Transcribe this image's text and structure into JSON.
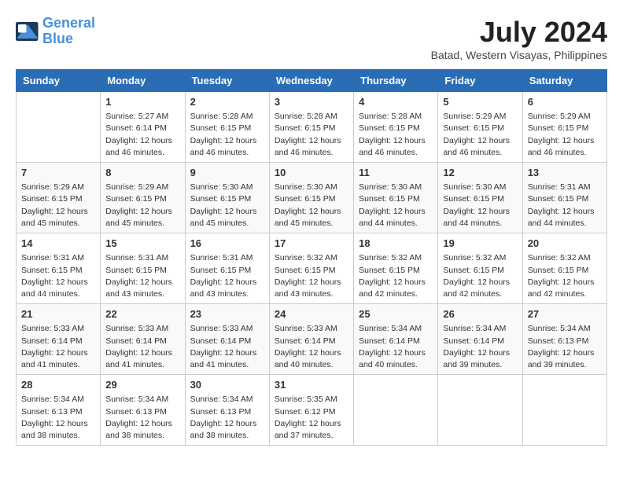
{
  "header": {
    "logo_line1": "General",
    "logo_line2": "Blue",
    "title": "July 2024",
    "subtitle": "Batad, Western Visayas, Philippines"
  },
  "columns": [
    "Sunday",
    "Monday",
    "Tuesday",
    "Wednesday",
    "Thursday",
    "Friday",
    "Saturday"
  ],
  "weeks": [
    {
      "days": [
        {
          "num": "",
          "info": ""
        },
        {
          "num": "1",
          "info": "Sunrise: 5:27 AM\nSunset: 6:14 PM\nDaylight: 12 hours\nand 46 minutes."
        },
        {
          "num": "2",
          "info": "Sunrise: 5:28 AM\nSunset: 6:15 PM\nDaylight: 12 hours\nand 46 minutes."
        },
        {
          "num": "3",
          "info": "Sunrise: 5:28 AM\nSunset: 6:15 PM\nDaylight: 12 hours\nand 46 minutes."
        },
        {
          "num": "4",
          "info": "Sunrise: 5:28 AM\nSunset: 6:15 PM\nDaylight: 12 hours\nand 46 minutes."
        },
        {
          "num": "5",
          "info": "Sunrise: 5:29 AM\nSunset: 6:15 PM\nDaylight: 12 hours\nand 46 minutes."
        },
        {
          "num": "6",
          "info": "Sunrise: 5:29 AM\nSunset: 6:15 PM\nDaylight: 12 hours\nand 46 minutes."
        }
      ]
    },
    {
      "days": [
        {
          "num": "7",
          "info": "Sunrise: 5:29 AM\nSunset: 6:15 PM\nDaylight: 12 hours\nand 45 minutes."
        },
        {
          "num": "8",
          "info": "Sunrise: 5:29 AM\nSunset: 6:15 PM\nDaylight: 12 hours\nand 45 minutes."
        },
        {
          "num": "9",
          "info": "Sunrise: 5:30 AM\nSunset: 6:15 PM\nDaylight: 12 hours\nand 45 minutes."
        },
        {
          "num": "10",
          "info": "Sunrise: 5:30 AM\nSunset: 6:15 PM\nDaylight: 12 hours\nand 45 minutes."
        },
        {
          "num": "11",
          "info": "Sunrise: 5:30 AM\nSunset: 6:15 PM\nDaylight: 12 hours\nand 44 minutes."
        },
        {
          "num": "12",
          "info": "Sunrise: 5:30 AM\nSunset: 6:15 PM\nDaylight: 12 hours\nand 44 minutes."
        },
        {
          "num": "13",
          "info": "Sunrise: 5:31 AM\nSunset: 6:15 PM\nDaylight: 12 hours\nand 44 minutes."
        }
      ]
    },
    {
      "days": [
        {
          "num": "14",
          "info": "Sunrise: 5:31 AM\nSunset: 6:15 PM\nDaylight: 12 hours\nand 44 minutes."
        },
        {
          "num": "15",
          "info": "Sunrise: 5:31 AM\nSunset: 6:15 PM\nDaylight: 12 hours\nand 43 minutes."
        },
        {
          "num": "16",
          "info": "Sunrise: 5:31 AM\nSunset: 6:15 PM\nDaylight: 12 hours\nand 43 minutes."
        },
        {
          "num": "17",
          "info": "Sunrise: 5:32 AM\nSunset: 6:15 PM\nDaylight: 12 hours\nand 43 minutes."
        },
        {
          "num": "18",
          "info": "Sunrise: 5:32 AM\nSunset: 6:15 PM\nDaylight: 12 hours\nand 42 minutes."
        },
        {
          "num": "19",
          "info": "Sunrise: 5:32 AM\nSunset: 6:15 PM\nDaylight: 12 hours\nand 42 minutes."
        },
        {
          "num": "20",
          "info": "Sunrise: 5:32 AM\nSunset: 6:15 PM\nDaylight: 12 hours\nand 42 minutes."
        }
      ]
    },
    {
      "days": [
        {
          "num": "21",
          "info": "Sunrise: 5:33 AM\nSunset: 6:14 PM\nDaylight: 12 hours\nand 41 minutes."
        },
        {
          "num": "22",
          "info": "Sunrise: 5:33 AM\nSunset: 6:14 PM\nDaylight: 12 hours\nand 41 minutes."
        },
        {
          "num": "23",
          "info": "Sunrise: 5:33 AM\nSunset: 6:14 PM\nDaylight: 12 hours\nand 41 minutes."
        },
        {
          "num": "24",
          "info": "Sunrise: 5:33 AM\nSunset: 6:14 PM\nDaylight: 12 hours\nand 40 minutes."
        },
        {
          "num": "25",
          "info": "Sunrise: 5:34 AM\nSunset: 6:14 PM\nDaylight: 12 hours\nand 40 minutes."
        },
        {
          "num": "26",
          "info": "Sunrise: 5:34 AM\nSunset: 6:14 PM\nDaylight: 12 hours\nand 39 minutes."
        },
        {
          "num": "27",
          "info": "Sunrise: 5:34 AM\nSunset: 6:13 PM\nDaylight: 12 hours\nand 39 minutes."
        }
      ]
    },
    {
      "days": [
        {
          "num": "28",
          "info": "Sunrise: 5:34 AM\nSunset: 6:13 PM\nDaylight: 12 hours\nand 38 minutes."
        },
        {
          "num": "29",
          "info": "Sunrise: 5:34 AM\nSunset: 6:13 PM\nDaylight: 12 hours\nand 38 minutes."
        },
        {
          "num": "30",
          "info": "Sunrise: 5:34 AM\nSunset: 6:13 PM\nDaylight: 12 hours\nand 38 minutes."
        },
        {
          "num": "31",
          "info": "Sunrise: 5:35 AM\nSunset: 6:12 PM\nDaylight: 12 hours\nand 37 minutes."
        },
        {
          "num": "",
          "info": ""
        },
        {
          "num": "",
          "info": ""
        },
        {
          "num": "",
          "info": ""
        }
      ]
    }
  ]
}
